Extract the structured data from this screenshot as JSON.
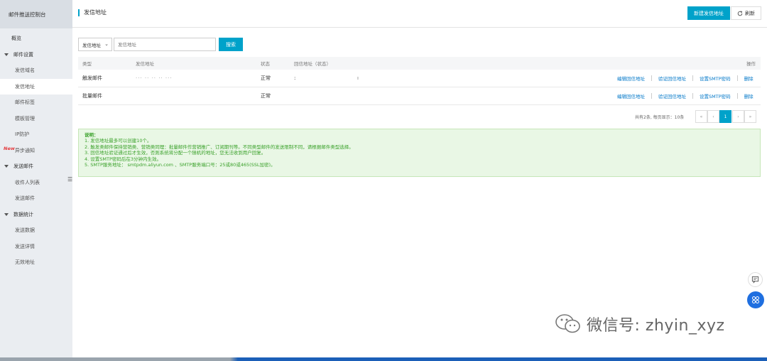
{
  "sidebar": {
    "header": "邮件推送控制台",
    "overview": "概览",
    "groups": [
      {
        "label": "邮件设置",
        "items": [
          "发信域名",
          "发信地址",
          "邮件标签",
          "模板管理",
          "IP防护",
          "异步通知"
        ]
      },
      {
        "label": "发送邮件",
        "items": [
          "收件人列表",
          "发送邮件"
        ]
      },
      {
        "label": "数据统计",
        "items": [
          "发送数据",
          "发送详情",
          "无效地址"
        ]
      }
    ],
    "new_badge": "New",
    "collapse_glyph": "☰"
  },
  "header": {
    "title": "发信地址",
    "create_button": "新建发信地址",
    "refresh_button": "刷新"
  },
  "filter": {
    "select_value": "发信地址",
    "input_placeholder": "发信地址",
    "search_button": "搜索"
  },
  "table": {
    "columns": {
      "type": "类型",
      "address": "发信地址",
      "status": "状态",
      "reply": "回信地址（状态）",
      "ops": "操作"
    },
    "rows": [
      {
        "type": "触发邮件",
        "address": "··· ·· ·· ·· ···",
        "status": "正常",
        "reply": ":",
        "reply_suffix": "ı"
      },
      {
        "type": "批量邮件",
        "address": "",
        "status": "正常",
        "reply": "",
        "reply_suffix": ""
      }
    ],
    "ops": [
      "编辑回信地址",
      "验证回信地址",
      "设置SMTP密码",
      "删除"
    ]
  },
  "pagination": {
    "summary": "共有2条, 每页显示：10条",
    "first": "«",
    "prev": "‹",
    "current": "1",
    "next": "›",
    "last": "»"
  },
  "notice": {
    "title": "说明：",
    "lines": [
      "1. 发信地址最多可以创建10个。",
      "2. 触发类邮件保持营销类、营销类同理：批量邮件作营销推广、订阅期刊等。不同类型邮件的发送限制不同，请根据邮件类型选择。",
      "3. 回信地址验证通过后才生效，否则系统将分配一个随机的地址，您无法收到用户回复。",
      "4. 设置SMTP密码后在3分钟内生效。",
      "5. SMTP服务地址： smtpdm.aliyun.com 、SMTP服务端口号：25或80或465(SSL加密)。"
    ]
  },
  "watermark": {
    "text": "微信号: zhyin_xyz"
  },
  "colors": {
    "accent": "#00a2ca",
    "link": "#0077c8",
    "notice_text": "#3aa12a",
    "notice_bg": "#e9f7e5",
    "sidebar_bg": "#eaedf1"
  }
}
